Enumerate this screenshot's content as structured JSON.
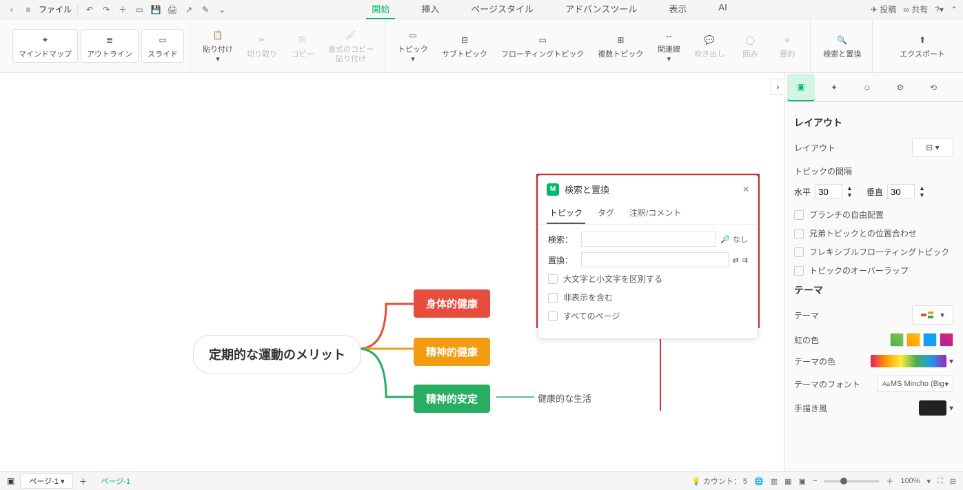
{
  "top": {
    "file_menu": "ファイル",
    "tabs": [
      "開始",
      "挿入",
      "ページスタイル",
      "アドバンスツール",
      "表示",
      "AI"
    ],
    "active_tab": 0,
    "post": "投稿",
    "share": "共有"
  },
  "ribbon": {
    "view_modes": {
      "mindmap": "マインドマップ",
      "outline": "アウトライン",
      "slide": "スライド"
    },
    "paste": "貼り付け",
    "cut": "切り取り",
    "copy": "コピー",
    "format_paste": "書式のコピー\n貼り付け",
    "topic": "トピック",
    "subtopic": "サブトピック",
    "floating_topic": "フローティングトピック",
    "multi_topic": "複数トピック",
    "relation": "関連線",
    "callout": "吹き出し",
    "boundary": "囲み",
    "summary": "要約",
    "find_replace": "検索と置換",
    "export": "エクスポート"
  },
  "mindmap": {
    "root": "定期的な運動のメリット",
    "n1": "身体的健康",
    "n2": "精神的健康",
    "n3": "精神的安定",
    "leaf": "健康的な生活"
  },
  "find": {
    "title": "検索と置換",
    "tabs": {
      "topic": "トピック",
      "tag": "タグ",
      "comment": "注釈/コメント"
    },
    "search_label": "検索：",
    "replace_label": "置換：",
    "none": "なし",
    "chk_case": "大文字と小文字を区別する",
    "chk_hidden": "非表示を含む",
    "chk_all_pages": "すべてのページ"
  },
  "panel": {
    "layout_title": "レイアウト",
    "layout_label": "レイアウト",
    "spacing_title": "トピックの間隔",
    "horiz": "水平",
    "horiz_val": "30",
    "vert": "垂直",
    "vert_val": "30",
    "chk_free": "ブランチの自由配置",
    "chk_sibling": "兄弟トピックとの位置合わせ",
    "chk_flex_float": "フレキシブルフローティングトピック",
    "chk_overlap": "トピックのオーバーラップ",
    "theme_title": "テーマ",
    "theme_label": "テーマ",
    "rainbow": "虹の色",
    "theme_color": "テーマの色",
    "theme_font": "テーマのフォント",
    "font_value": "MS Mincho (Big",
    "handdrawn": "手描き風"
  },
  "status": {
    "page1": "ページ-1",
    "page_current": "ページ-1",
    "count_label": "カウント：",
    "count_val": "5",
    "zoom": "100%"
  }
}
